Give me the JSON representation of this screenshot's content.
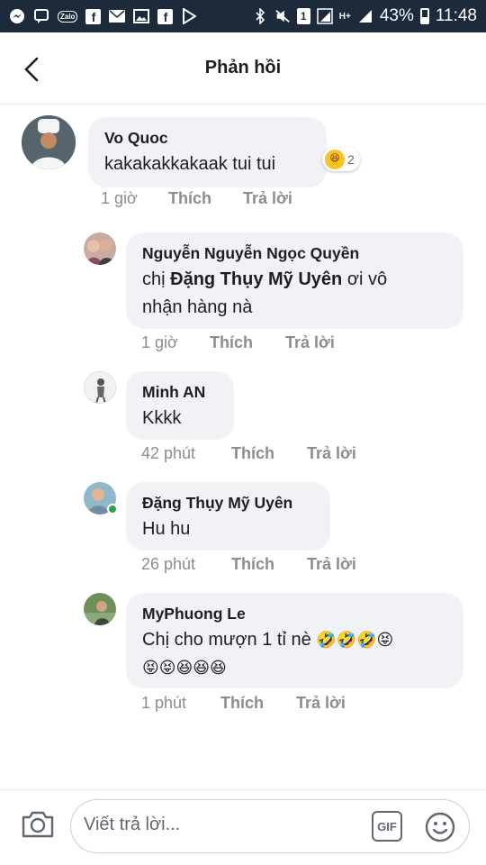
{
  "status_bar": {
    "battery": "43%",
    "time": "11:48",
    "network": "H+",
    "sim": "1"
  },
  "header": {
    "title": "Phản hồi"
  },
  "comments": [
    {
      "author": "Vo Quoc",
      "text": "kakakakkakaak tui tui",
      "time": "1 giờ",
      "like": "Thích",
      "reply": "Trả lời",
      "reaction_icon": "haha-emoji",
      "reaction_count": "2"
    },
    {
      "author": "Nguyễn Nguyễn Ngọc Quyền",
      "text_prefix": "chị ",
      "mention": "Đặng Thụy Mỹ Uyên",
      "text_suffix": " ơi vô",
      "text_line2": "nhận hàng nà",
      "time": "1 giờ",
      "like": "Thích",
      "reply": "Trả lời"
    },
    {
      "author": "Minh AN",
      "text": "Kkkk",
      "time": "42 phút",
      "like": "Thích",
      "reply": "Trả lời"
    },
    {
      "author": "Đặng Thụy Mỹ Uyên",
      "text": "Hu hu",
      "time": "26 phút",
      "like": "Thích",
      "reply": "Trả lời"
    },
    {
      "author": "MyPhuong Le",
      "text": "Chị cho mượn 1 tỉ nè",
      "emoji_line1": "🤣🤣🤣😝",
      "emoji_line2": "😝😝😆😆😆",
      "time": "1 phút",
      "like": "Thích",
      "reply": "Trả lời"
    }
  ],
  "composer": {
    "placeholder": "Viết trả lời...",
    "gif_label": "GIF"
  },
  "colors": {
    "status_bar": "#1d2a3a",
    "bubble": "#f0f2f5",
    "meta_text": "#8a8d91",
    "online": "#31a24c"
  }
}
